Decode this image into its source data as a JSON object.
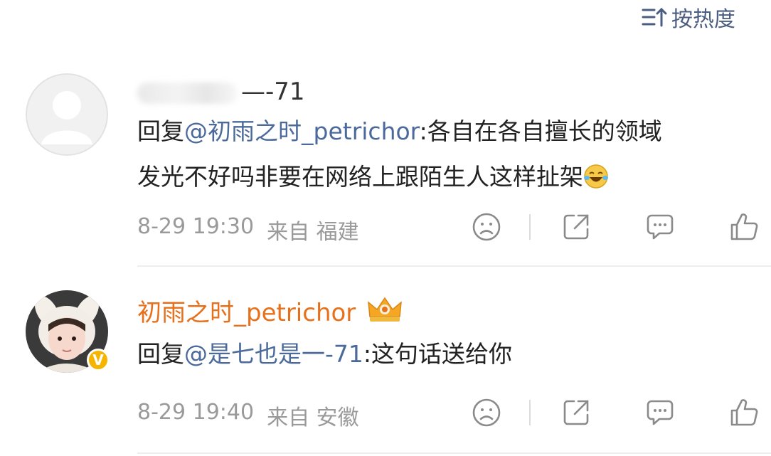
{
  "sort": {
    "label": "按热度",
    "icon": "sort-icon"
  },
  "comments": [
    {
      "username": "—-71",
      "avatar_icon": "default-avatar-icon",
      "reply_prefix": "回复",
      "mention": "@初雨之时_petrichor",
      "text_line1": ":各自在各自擅长的领域",
      "text_line2": "发光不好吗非要在网络上跟陌生人这样扯架",
      "emoji": "laughing-tears-emoji",
      "time": "8-29 19:30",
      "location": "来自 福建"
    },
    {
      "username": "初雨之时_petrichor",
      "avatar_icon": "user-photo-avatar",
      "verified_badge": "V",
      "level_badge": "crown-badge-icon",
      "reply_prefix": "回复",
      "mention": "@是七也是一-71",
      "text_line1": ":这句话送给你",
      "time": "8-29 19:40",
      "location": "来自 安徽"
    }
  ],
  "colors": {
    "accent": "#4b6a9b",
    "vip_name": "#e8701a",
    "meta": "#9a9a9a",
    "badge": "#f4b400"
  }
}
